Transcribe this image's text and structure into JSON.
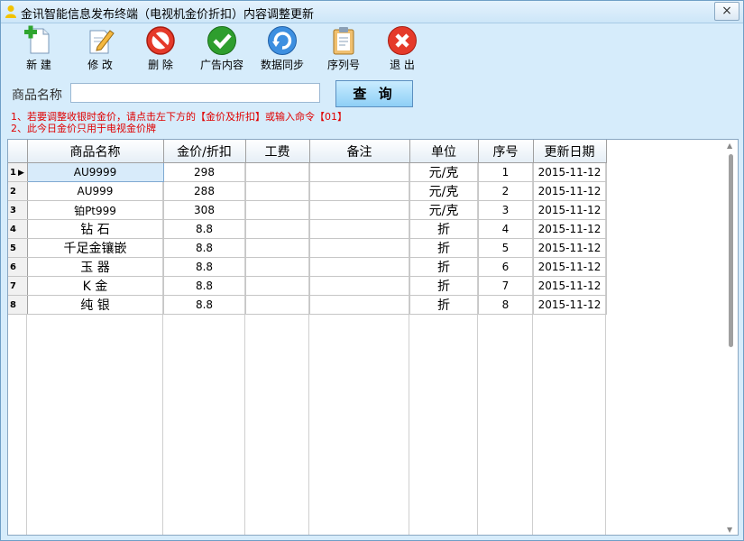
{
  "window": {
    "title": "金讯智能信息发布终端（电视机金价折扣）内容调整更新",
    "close_label": "×"
  },
  "toolbar": [
    {
      "label": "新 建",
      "icon": "new-document-icon"
    },
    {
      "label": "修 改",
      "icon": "edit-pencil-icon"
    },
    {
      "label": "删 除",
      "icon": "delete-prohibit-icon"
    },
    {
      "label": "广告内容",
      "icon": "check-ok-icon"
    },
    {
      "label": "数据同步",
      "icon": "sync-refresh-icon"
    },
    {
      "label": "序列号",
      "icon": "clipboard-icon"
    },
    {
      "label": "退 出",
      "icon": "exit-close-icon"
    }
  ],
  "search": {
    "label": "商品名称",
    "value": "",
    "button_label": "查 询"
  },
  "hints": [
    "1、若要调整收银时金价，请点击左下方的【金价及折扣】或输入命令【01】",
    "2、此今日金价只用于电视金价牌"
  ],
  "table": {
    "headers": [
      "商品名称",
      "金价/折扣",
      "工费",
      "备注",
      "单位",
      "序号",
      "更新日期"
    ],
    "rows": [
      {
        "row": "1",
        "name": "AU9999",
        "price": "298",
        "fee": "",
        "note": "",
        "unit": "元/克",
        "seq": "1",
        "date": "2015-11-12"
      },
      {
        "row": "2",
        "name": "AU999",
        "price": "288",
        "fee": "",
        "note": "",
        "unit": "元/克",
        "seq": "2",
        "date": "2015-11-12"
      },
      {
        "row": "3",
        "name": "铂Pt999",
        "price": "308",
        "fee": "",
        "note": "",
        "unit": "元/克",
        "seq": "3",
        "date": "2015-11-12"
      },
      {
        "row": "4",
        "name": "钻 石",
        "price": "8.8",
        "fee": "",
        "note": "",
        "unit": "折",
        "seq": "4",
        "date": "2015-11-12"
      },
      {
        "row": "5",
        "name": "千足金镶嵌",
        "price": "8.8",
        "fee": "",
        "note": "",
        "unit": "折",
        "seq": "5",
        "date": "2015-11-12"
      },
      {
        "row": "6",
        "name": "玉 器",
        "price": "8.8",
        "fee": "",
        "note": "",
        "unit": "折",
        "seq": "6",
        "date": "2015-11-12"
      },
      {
        "row": "7",
        "name": "K 金",
        "price": "8.8",
        "fee": "",
        "note": "",
        "unit": "折",
        "seq": "7",
        "date": "2015-11-12"
      },
      {
        "row": "8",
        "name": "纯 银",
        "price": "8.8",
        "fee": "",
        "note": "",
        "unit": "折",
        "seq": "8",
        "date": "2015-11-12"
      }
    ],
    "selected_row": 1
  },
  "colors": {
    "hint_text": "#e00000",
    "window_bg": "#d6ecfb",
    "selected_cell": "#d8ebfa"
  }
}
